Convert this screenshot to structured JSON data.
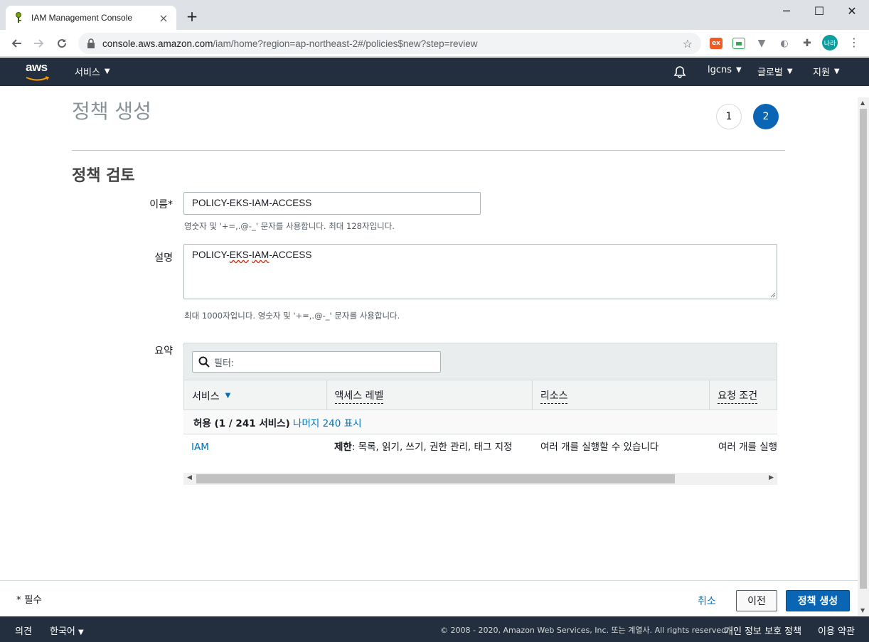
{
  "browser": {
    "tab_title": "IAM Management Console",
    "tab_close": "×",
    "new_tab": "+",
    "url_host": "console.aws.amazon.com",
    "url_path": "/iam/home?region=ap-northeast-2#/policies$new?step=review",
    "profile_initials": "나라",
    "window_minimize": "─",
    "window_maximize": "☐",
    "window_close": "✕",
    "extension_1_label": "ex"
  },
  "aws_nav": {
    "logo": "aws",
    "services": "서비스",
    "account": "lgcns",
    "region": "글로벌",
    "support": "지원"
  },
  "page": {
    "title": "정책 생성",
    "steps": [
      "1",
      "2"
    ],
    "active_step": 2,
    "section_title": "정책 검토"
  },
  "form": {
    "name_label": "이름*",
    "name_value": "POLICY-EKS-IAM-ACCESS",
    "name_hint": "영숫자 및 '+=,.@-_' 문자를 사용합니다. 최대 128자입니다.",
    "desc_label": "설명",
    "desc_value_parts": [
      "POLICY-",
      "EKS",
      "-",
      "IAM",
      "-ACCESS"
    ],
    "desc_hint": "최대 1000자입니다. 영숫자 및 '+=,.@-_' 문자를 사용합니다.",
    "summary_label": "요약"
  },
  "summary": {
    "filter_placeholder": "필터:",
    "columns": [
      "서비스",
      "액세스 레벨",
      "리소스",
      "요청 조건"
    ],
    "group": {
      "prefix": "허용 (1 / 241 서비스)",
      "link": "나머지 240 표시"
    },
    "rows": [
      {
        "service": "IAM",
        "access_level_bold": "제한",
        "access_level_rest": ": 목록, 읽기, 쓰기, 권한 관리, 태그 지정",
        "resource": "여러 개를 실행할 수 있습니다",
        "condition": "여러 개를 실행할 수 있습니다"
      }
    ]
  },
  "actions": {
    "required_note": "* 필수",
    "cancel": "취소",
    "previous": "이전",
    "create": "정책 생성"
  },
  "footer": {
    "feedback": "의견",
    "language": "한국어",
    "copyright": "© 2008 - 2020, Amazon Web Services, Inc. 또는 계열사. All rights reserved.",
    "privacy": "개인 정보 보호 정책",
    "terms": "이용 약관"
  },
  "colors": {
    "aws_navy": "#232f3e",
    "primary_blue": "#0a66b5",
    "link_blue": "#0073bb",
    "aws_orange": "#ff9900"
  }
}
